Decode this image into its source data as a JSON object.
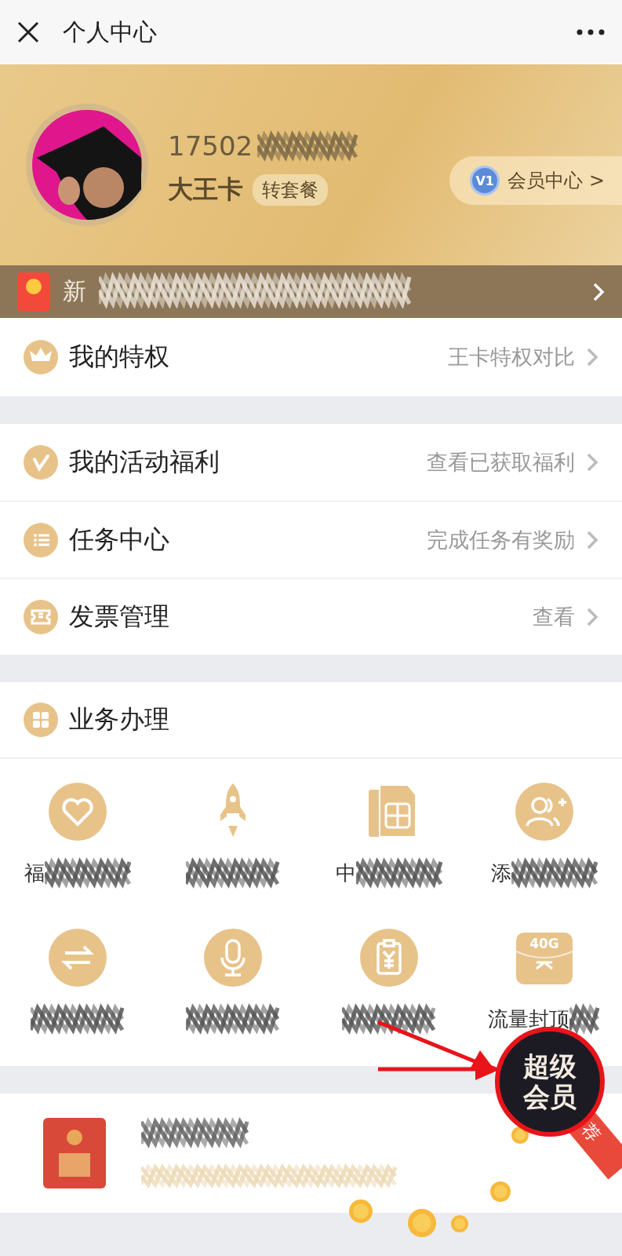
{
  "header": {
    "title": "个人中心"
  },
  "banner": {
    "phone": "17502",
    "name": "大王卡",
    "plan_button": "转套餐",
    "level_badge": "V1",
    "member_link": "会员中心 >",
    "notice": "新"
  },
  "privilege": {
    "kind": "crown",
    "label": "我的特权",
    "link": "王卡特权对比"
  },
  "menu": [
    {
      "kind": "v",
      "label": "我的活动福利",
      "link": "查看已获取福利"
    },
    {
      "kind": "list",
      "label": "任务中心",
      "link": "完成任务有奖励"
    },
    {
      "kind": "ticket",
      "label": "发票管理",
      "link": "查看"
    }
  ],
  "services": {
    "title": "业务办理",
    "items": [
      {
        "kind": "heart",
        "label": "福"
      },
      {
        "kind": "rocket"
      },
      {
        "kind": "sim",
        "label": "中"
      },
      {
        "kind": "people",
        "label": "添"
      },
      {
        "kind": "swap"
      },
      {
        "kind": "mic"
      },
      {
        "kind": "bill"
      },
      {
        "kind": "data",
        "badge": "40G",
        "label": "流量封顶"
      }
    ]
  },
  "float_badge": {
    "lines": [
      "超级",
      "会员"
    ],
    "ribbon": "荐"
  }
}
